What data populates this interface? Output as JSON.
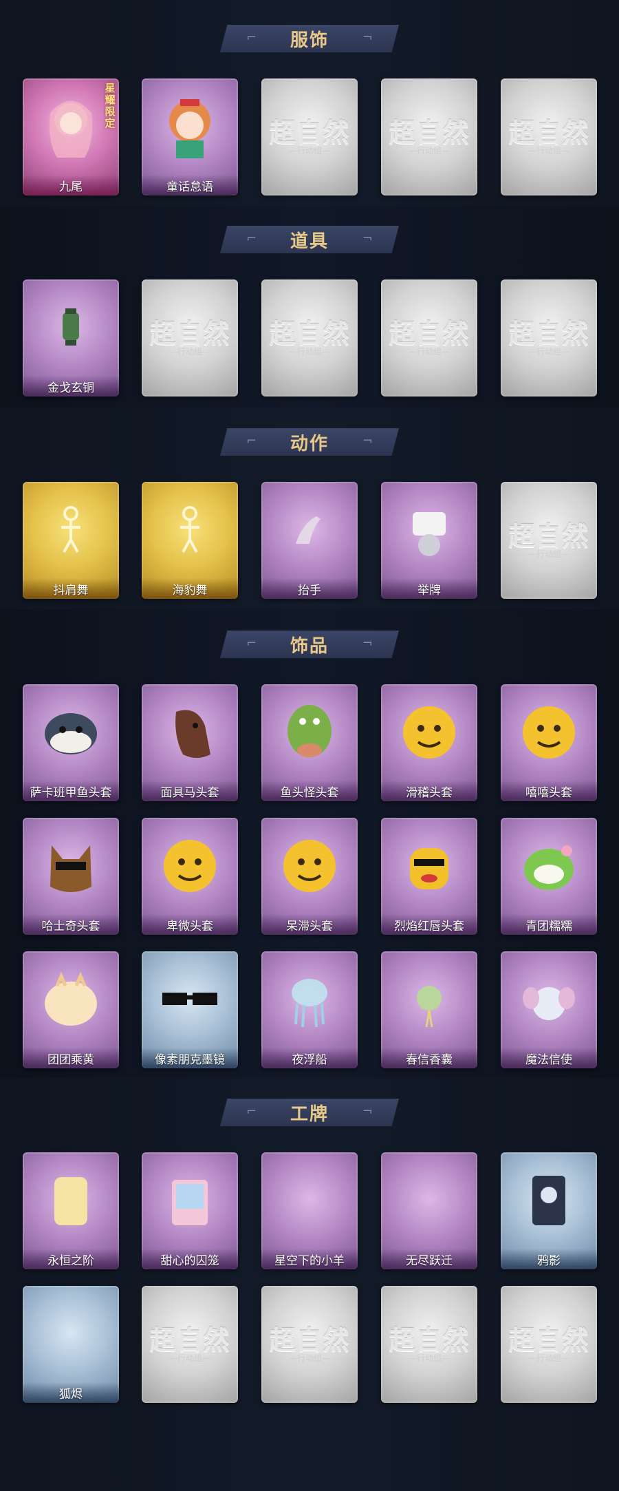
{
  "sections": [
    {
      "title": "服饰",
      "items": [
        {
          "label": "九尾",
          "kind": "pink",
          "icon": "nine-tails-character-icon",
          "badge": "星耀限定"
        },
        {
          "label": "童话怠语",
          "kind": "purple",
          "icon": "fairy-tale-character-icon"
        },
        {
          "kind": "grey",
          "placeholder": "超自然",
          "placeholder_sub": "—行动组—"
        },
        {
          "kind": "grey",
          "placeholder": "超自然",
          "placeholder_sub": "—行动组—"
        },
        {
          "kind": "grey",
          "placeholder": "超自然",
          "placeholder_sub": "—行动组—"
        }
      ]
    },
    {
      "title": "道具",
      "items": [
        {
          "label": "金戈玄铜",
          "kind": "purple",
          "icon": "bronze-lantern-icon"
        },
        {
          "kind": "grey",
          "placeholder": "超自然",
          "placeholder_sub": "—行动组—"
        },
        {
          "kind": "grey",
          "placeholder": "超自然",
          "placeholder_sub": "—行动组—"
        },
        {
          "kind": "grey",
          "placeholder": "超自然",
          "placeholder_sub": "—行动组—"
        },
        {
          "kind": "grey",
          "placeholder": "超自然",
          "placeholder_sub": "—行动组—"
        }
      ]
    },
    {
      "title": "动作",
      "items": [
        {
          "label": "抖肩舞",
          "kind": "gold",
          "icon": "shoulder-dance-icon"
        },
        {
          "label": "海豹舞",
          "kind": "gold",
          "icon": "seal-dance-icon"
        },
        {
          "label": "抬手",
          "kind": "purple",
          "icon": "raise-hand-icon"
        },
        {
          "label": "举牌",
          "kind": "purple",
          "icon": "hold-sign-icon"
        },
        {
          "kind": "grey",
          "placeholder": "超自然",
          "placeholder_sub": "—行动组—"
        }
      ]
    },
    {
      "title": "饰品",
      "items": [
        {
          "label": "萨卡班甲鱼头套",
          "kind": "purple",
          "icon": "fish-head-mask-icon"
        },
        {
          "label": "面具马头套",
          "kind": "purple",
          "icon": "horse-head-mask-icon"
        },
        {
          "label": "鱼头怪头套",
          "kind": "purple",
          "icon": "fish-monster-mask-icon"
        },
        {
          "label": "滑稽头套",
          "kind": "purple",
          "icon": "smirk-face-mask-icon"
        },
        {
          "label": "嘻嘻头套",
          "kind": "purple",
          "icon": "grin-face-mask-icon"
        },
        {
          "label": "哈士奇头套",
          "kind": "purple",
          "icon": "husky-mask-icon"
        },
        {
          "label": "卑微头套",
          "kind": "purple",
          "icon": "humble-face-mask-icon"
        },
        {
          "label": "呆滞头套",
          "kind": "purple",
          "icon": "dazed-face-mask-icon"
        },
        {
          "label": "烈焰红唇头套",
          "kind": "purple",
          "icon": "red-lips-mask-icon"
        },
        {
          "label": "青团糯糯",
          "kind": "purple",
          "icon": "green-rice-ball-icon"
        },
        {
          "label": "团团乘黄",
          "kind": "purple",
          "icon": "round-creature-icon"
        },
        {
          "label": "像素朋克墨镜",
          "kind": "blue",
          "icon": "pixel-sunglasses-icon"
        },
        {
          "label": "夜浮船",
          "kind": "purple",
          "icon": "jellyfish-icon"
        },
        {
          "label": "春信香囊",
          "kind": "purple",
          "icon": "sachet-icon"
        },
        {
          "label": "魔法信使",
          "kind": "purple",
          "icon": "elephant-messenger-icon"
        }
      ]
    },
    {
      "title": "工牌",
      "items": [
        {
          "label": "永恒之阶",
          "kind": "purple",
          "icon": "gold-badge-icon"
        },
        {
          "label": "甜心的囚笼",
          "kind": "purple",
          "icon": "pink-card-icon"
        },
        {
          "label": "星空下的小羊",
          "kind": "purple",
          "icon": "blank-badge-icon"
        },
        {
          "label": "无尽跃迁",
          "kind": "purple",
          "icon": "blank-badge-icon"
        },
        {
          "label": "鸦影",
          "kind": "blue",
          "icon": "raven-card-icon"
        },
        {
          "label": "狐烬",
          "kind": "blue",
          "icon": "blank-badge-icon"
        },
        {
          "kind": "grey",
          "placeholder": "超自然",
          "placeholder_sub": "—行动组—"
        },
        {
          "kind": "grey",
          "placeholder": "超自然",
          "placeholder_sub": "—行动组—"
        },
        {
          "kind": "grey",
          "placeholder": "超自然",
          "placeholder_sub": "—行动组—"
        },
        {
          "kind": "grey",
          "placeholder": "超自然",
          "placeholder_sub": "—行动组—"
        }
      ]
    }
  ],
  "colors": {
    "background": "#101723",
    "title_text": "#e9c98a",
    "title_banner": "#36405e",
    "rarity_purple": "#b58ac6",
    "rarity_gold": "#e5c24a",
    "rarity_blue": "#a9c0d6",
    "rarity_pink": "#d27ab6",
    "empty_grey": "#d2d2d2"
  }
}
